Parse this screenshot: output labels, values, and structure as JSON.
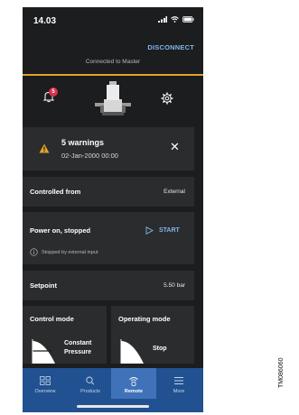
{
  "status_bar": {
    "time": "14.03"
  },
  "header": {
    "disconnect_label": "DISCONNECT",
    "connection_status": "Connected to Master"
  },
  "pump_header": {
    "notification_count": "5",
    "accent_color": "#e3a32a"
  },
  "warning": {
    "title": "5 warnings",
    "date": "02-Jan-2000 00:00"
  },
  "controlled_from": {
    "label": "Controlled from",
    "value": "External"
  },
  "power": {
    "label": "Power on, stopped",
    "start_label": "START",
    "note": "Stopped by external input"
  },
  "setpoint": {
    "label": "Setpoint",
    "value": "5.50 bar"
  },
  "control_mode": {
    "title": "Control mode",
    "value_line1": "Constant",
    "value_line2": "Pressure"
  },
  "operating_mode": {
    "title": "Operating mode",
    "value": "Stop"
  },
  "tabs": [
    {
      "label": "Overview",
      "icon": "grid-icon"
    },
    {
      "label": "Products",
      "icon": "search-icon"
    },
    {
      "label": "Remote",
      "icon": "remote-icon",
      "active": true
    },
    {
      "label": "More",
      "icon": "menu-icon"
    }
  ],
  "caption": "TM086060"
}
